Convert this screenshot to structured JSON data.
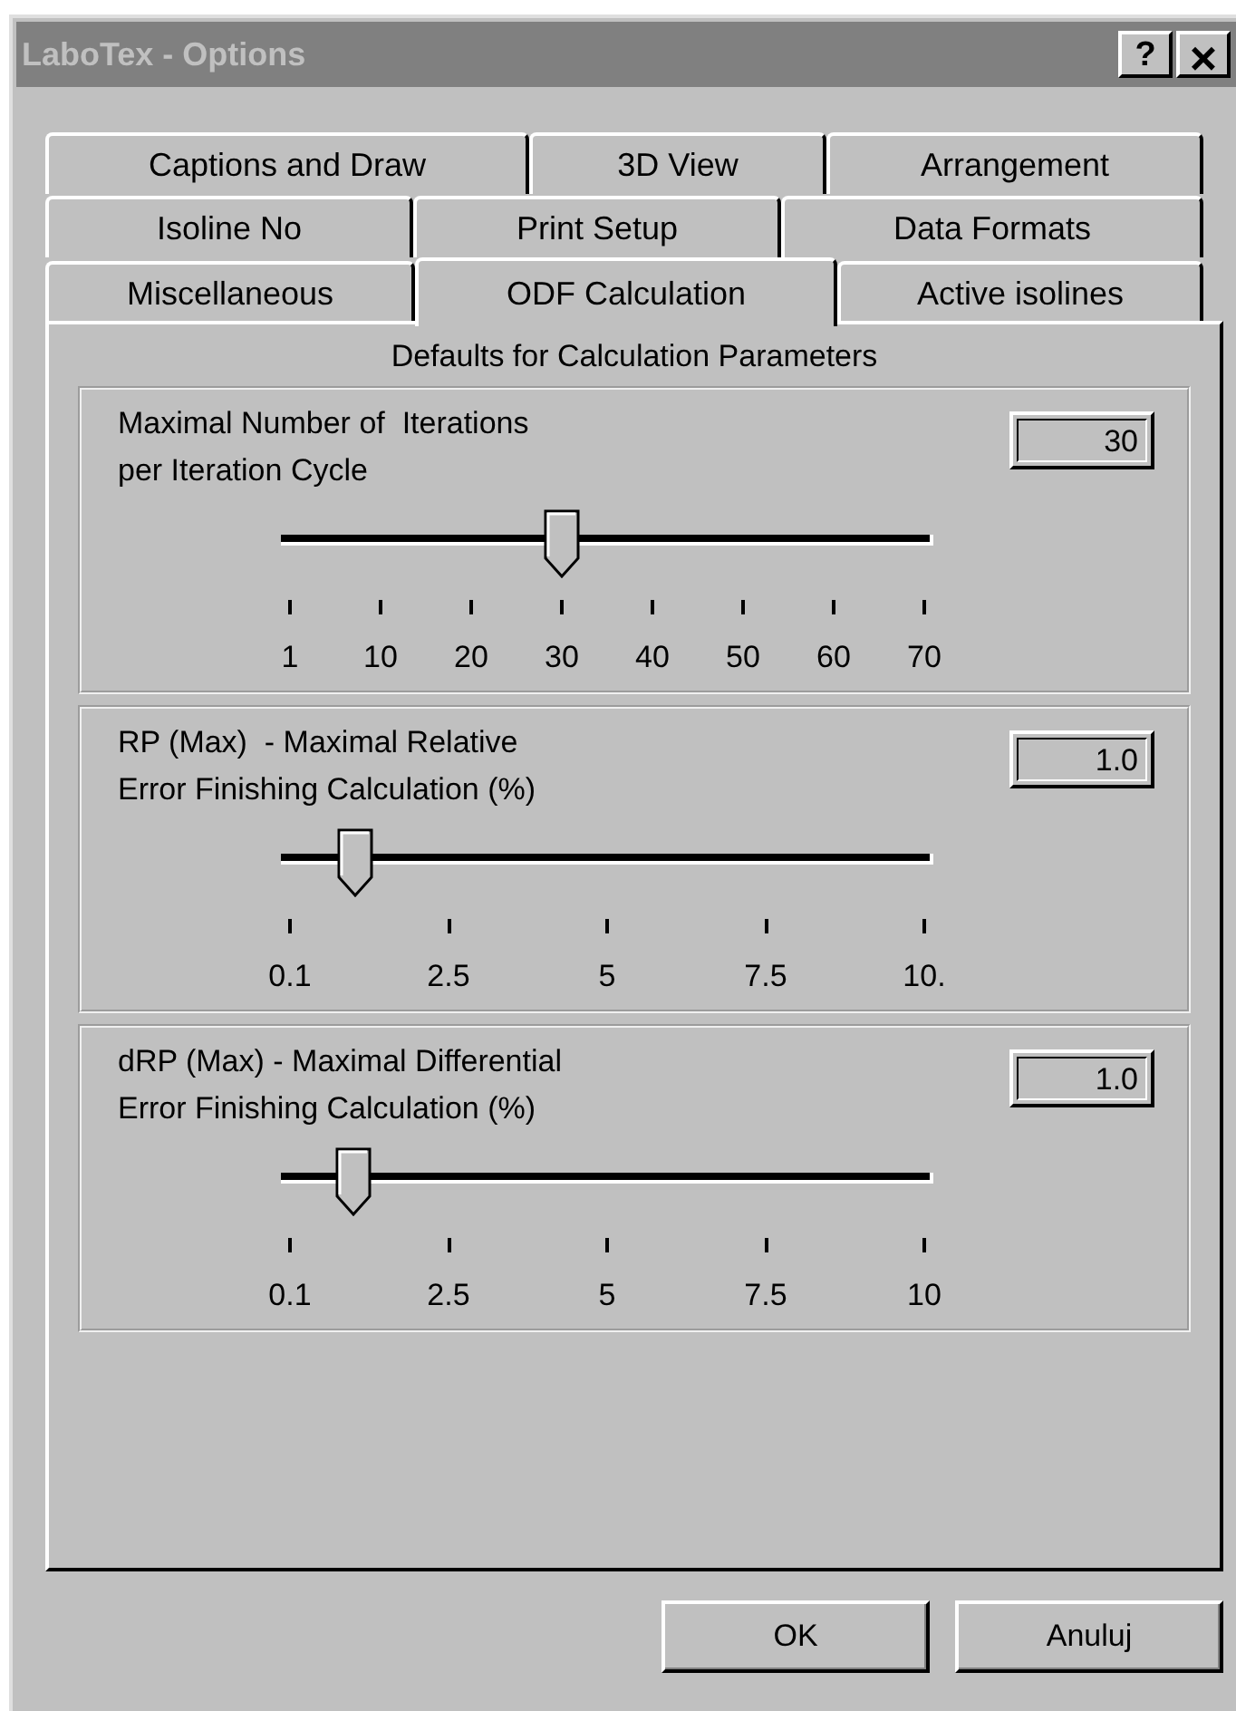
{
  "window": {
    "title": "LaboTex - Options",
    "active": false
  },
  "title_buttons": [
    {
      "label": "?",
      "kind": "help"
    },
    {
      "label": "×",
      "kind": "close"
    }
  ],
  "tab_rows": [
    [
      {
        "label": "Captions and Draw",
        "selected": false
      },
      {
        "label": "3D View",
        "selected": false
      },
      {
        "label": "Arrangement",
        "selected": false
      }
    ],
    [
      {
        "label": "Isoline No",
        "selected": false
      },
      {
        "label": "Print Setup",
        "selected": false
      },
      {
        "label": "Data Formats",
        "selected": false
      }
    ],
    [
      {
        "label": "Miscellaneous",
        "selected": false
      },
      {
        "label": "ODF Calculation",
        "selected": true
      },
      {
        "label": "Active isolines",
        "selected": false
      }
    ]
  ],
  "panel": {
    "heading": "Defaults for Calculation Parameters",
    "groups": [
      {
        "label_lines": [
          "Maximal Number of  Iterations",
          "per Iteration Cycle"
        ],
        "value": "30",
        "level": 0.43,
        "ticks": [
          "1",
          "10",
          "20",
          "30",
          "40",
          "50",
          "60",
          "70"
        ]
      },
      {
        "label_lines": [
          "RP (Max)  - Maximal Relative",
          "Error Finishing Calculation (%)"
        ],
        "value": "1.0",
        "level": 0.115,
        "ticks": [
          "0.1",
          "2.5",
          "5",
          "7.5",
          "10."
        ]
      },
      {
        "label_lines": [
          "dRP (Max) - Maximal Differential",
          "Error Finishing Calculation (%)"
        ],
        "value": "1.0",
        "level": 0.11,
        "ticks": [
          "0.1",
          "2.5",
          "5",
          "7.5",
          "10"
        ]
      }
    ]
  },
  "buttons": [
    "OK",
    "Anuluj"
  ]
}
